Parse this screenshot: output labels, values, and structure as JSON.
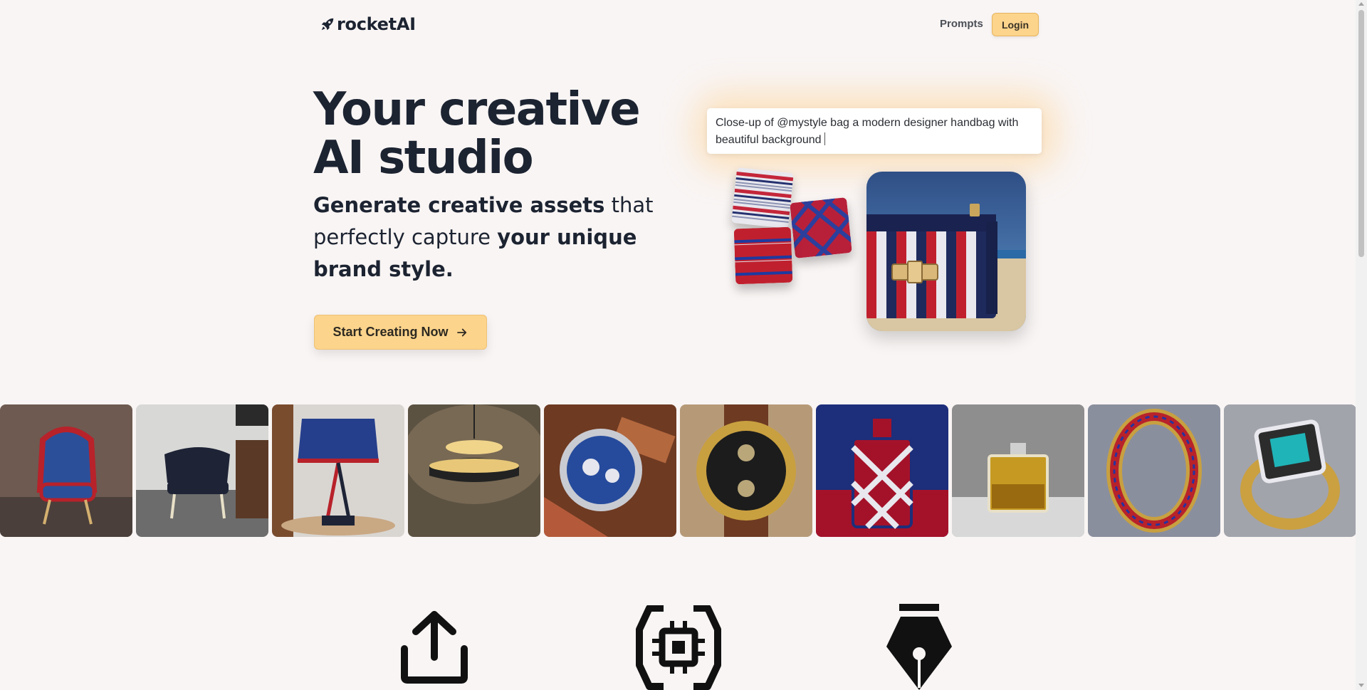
{
  "header": {
    "logo_text": "rocketAI",
    "logo_icon": "rocket-icon",
    "nav": {
      "prompts_label": "Prompts",
      "login_label": "Login"
    }
  },
  "hero": {
    "title": "Your creative AI studio",
    "subtitle": {
      "part1": "Generate creative assets",
      "part2": " that perfectly capture ",
      "part3": "your unique brand style."
    },
    "cta_label": "Start Creating Now",
    "cta_icon": "arrow-right-icon"
  },
  "prompt_demo": {
    "text": "Close-up of @mystyle bag a modern designer handbag with beautiful background"
  },
  "gallery": {
    "items": [
      "blue-red armchair",
      "black-white chair",
      "striped table lamp",
      "pendant lamp",
      "blue dial watch",
      "gold watch",
      "patterned perfume bottle",
      "gold perfume bottle",
      "red-blue gold ring",
      "teal gemstone ring"
    ]
  },
  "features": {
    "icons": [
      "upload-icon",
      "processor-icon",
      "pen-nib-icon"
    ]
  },
  "colors": {
    "accent": "#fcd48c",
    "background": "#f9f5f4",
    "text": "#1c2331"
  }
}
